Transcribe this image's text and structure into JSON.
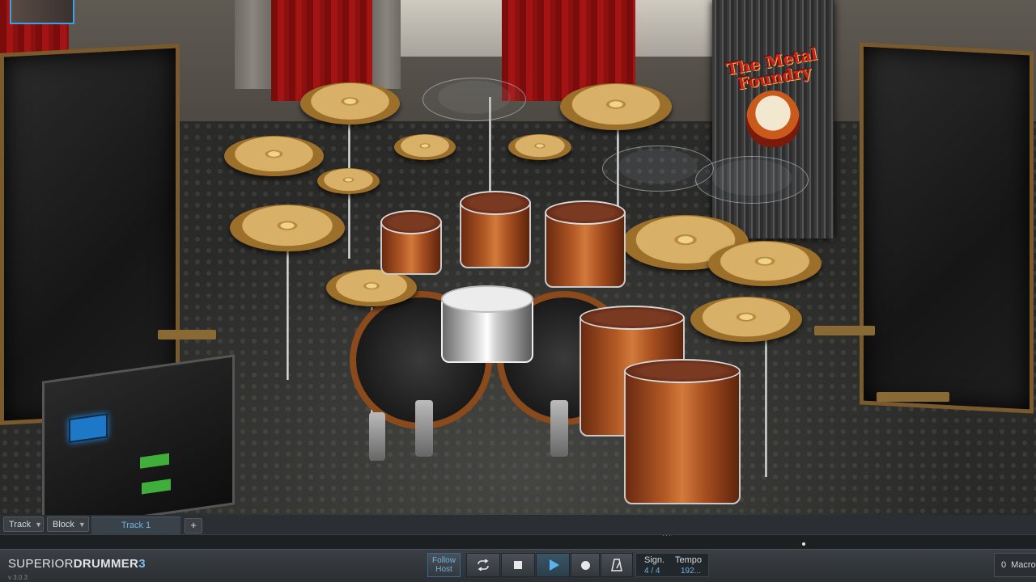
{
  "stage": {
    "banner": {
      "line1": "The Metal",
      "line2": "Foundry"
    }
  },
  "track_strip": {
    "track_menu": "Track",
    "block_menu": "Block",
    "active_tab": "Track 1",
    "add_track": "+"
  },
  "transport": {
    "logo_part1": "SUPERIOR",
    "logo_part2": "DRUMMER",
    "logo_number": "3",
    "version": "v 3.0.3",
    "follow_host_line1": "Follow",
    "follow_host_line2": "Host",
    "signature_label": "Sign.",
    "signature_value": "4 / 4",
    "tempo_label": "Tempo",
    "tempo_value": "192...",
    "macro_count": "0",
    "macro_label": "Macro"
  },
  "colors": {
    "accent": "#6ab5e8",
    "toolbar_bg": "#2b2f33",
    "panel_frame": "#7a5a2c"
  }
}
